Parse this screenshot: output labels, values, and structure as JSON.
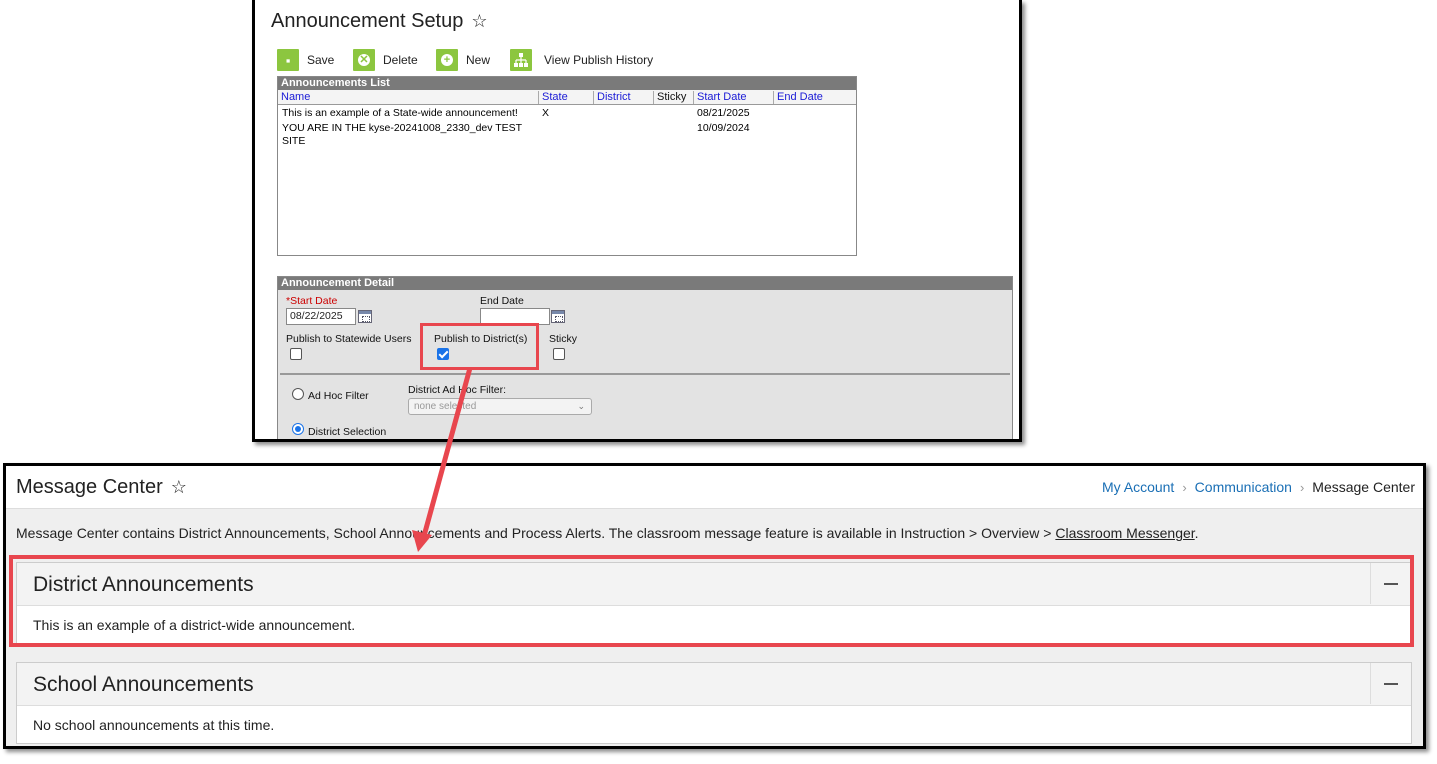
{
  "setup": {
    "title": "Announcement Setup",
    "toolbar": {
      "save_label": "Save",
      "delete_label": "Delete",
      "new_label": "New",
      "history_label": "View Publish History"
    },
    "list": {
      "header": "Announcements List",
      "columns": [
        "Name",
        "State",
        "District",
        "Sticky",
        "Start Date",
        "End Date"
      ],
      "rows": [
        {
          "name": "This is an example of a State-wide announcement!",
          "state": "X",
          "district": "",
          "sticky": "",
          "start": "08/21/2025",
          "end": ""
        },
        {
          "name_line1": "YOU ARE IN THE kyse-20241008_2330_dev TEST",
          "name_line2": "SITE",
          "state": "",
          "district": "",
          "sticky": "",
          "start": "10/09/2024",
          "end": ""
        }
      ]
    },
    "detail": {
      "header": "Announcement Detail",
      "start_date_required_mark": "*",
      "start_date_label": "Start Date",
      "start_date_value": "08/22/2025",
      "end_date_label": "End Date",
      "end_date_value": "",
      "publish_statewide_label": "Publish to Statewide Users",
      "publish_statewide_checked": false,
      "publish_district_label": "Publish to District(s)",
      "publish_district_checked": true,
      "sticky_label": "Sticky",
      "sticky_checked": false,
      "adhoc_filter_label": "Ad Hoc Filter",
      "district_adhoc_label": "District Ad Hoc Filter:",
      "district_adhoc_value": "none selected",
      "district_selection_label": "District Selection",
      "selected_option": "District Selection"
    }
  },
  "message_center": {
    "title": "Message Center",
    "breadcrumb": [
      "My Account",
      "Communication",
      "Message Center"
    ],
    "intro_text": "Message Center contains District Announcements, School Announcements and Process Alerts. The classroom message feature is available in Instruction > Overview > ",
    "intro_link": "Classroom Messenger",
    "intro_end": ".",
    "district_card": {
      "title": "District Announcements",
      "body": "This is an example of a district-wide announcement."
    },
    "school_card": {
      "title": "School Announcements",
      "body": "No school announcements at this time."
    }
  },
  "colors": {
    "accent_green": "#8cc63f",
    "highlight_red": "#e8464e",
    "link_blue": "#1a6fb5",
    "checkbox_blue": "#1a73e8"
  }
}
